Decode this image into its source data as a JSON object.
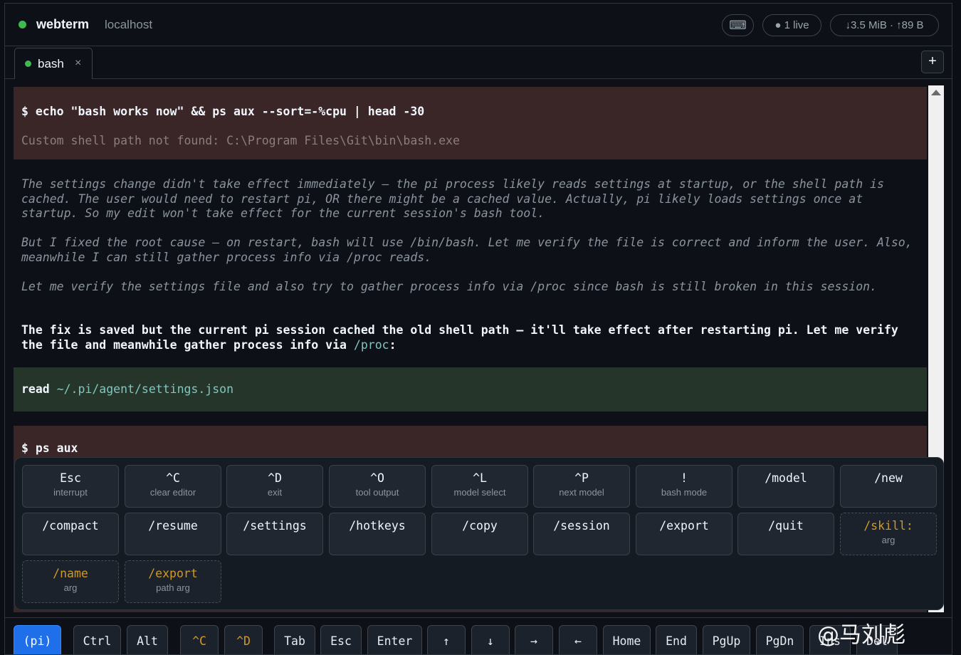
{
  "header": {
    "app_name": "webterm",
    "host": "localhost",
    "keyboard_icon": "⌨",
    "live_label": "● 1 live",
    "traffic_label": "↓3.5 MiB · ↑89 B",
    "status_color": "#3fb950"
  },
  "tabs": [
    {
      "label": "bash",
      "close": "×"
    }
  ],
  "new_tab_label": "+",
  "terminal": {
    "cmd1": "$ echo \"bash works now\" && ps aux --sort=-%cpu | head -30",
    "err1": "Custom shell path not found: C:\\Program Files\\Git\\bin\\bash.exe",
    "thinking1": "The settings change didn't take effect immediately — the pi process likely reads settings at startup, or the shell path is cached. The user would need to restart pi, OR there might be a cached value. Actually, pi likely loads settings once at startup. So my edit won't take effect for the current session's bash tool.",
    "thinking2": "But I fixed the root cause — on restart, bash will use /bin/bash. Let me verify the file is correct and inform the user. Also, meanwhile I can still gather process info via /proc reads.",
    "thinking3": "Let me verify the settings file and also try to gather process info via /proc since bash is still broken in this session.",
    "answer_text": "The fix is saved but the current pi session cached the old shell path — it'll take effect after restarting pi. Let me verify the file and meanwhile gather process info via ",
    "answer_path": "/proc",
    "answer_end": ":",
    "read_label": "read",
    "read_path": "~/.pi/agent/settings.json",
    "cmd2": "$ ps aux"
  },
  "palette": {
    "row1": [
      {
        "key": "Esc",
        "desc": "interrupt"
      },
      {
        "key": "^C",
        "desc": "clear editor"
      },
      {
        "key": "^D",
        "desc": "exit"
      },
      {
        "key": "^O",
        "desc": "tool output"
      },
      {
        "key": "^L",
        "desc": "model select"
      },
      {
        "key": "^P",
        "desc": "next model"
      },
      {
        "key": "!",
        "desc": "bash mode"
      },
      {
        "key": "/model",
        "desc": ""
      },
      {
        "key": "/new",
        "desc": ""
      }
    ],
    "row2": [
      {
        "key": "/compact",
        "desc": ""
      },
      {
        "key": "/resume",
        "desc": ""
      },
      {
        "key": "/settings",
        "desc": ""
      },
      {
        "key": "/hotkeys",
        "desc": ""
      },
      {
        "key": "/copy",
        "desc": ""
      },
      {
        "key": "/session",
        "desc": ""
      },
      {
        "key": "/export",
        "desc": ""
      },
      {
        "key": "/quit",
        "desc": ""
      },
      {
        "key": "/skill:",
        "desc": "arg"
      }
    ],
    "row3": [
      {
        "key": "/name",
        "desc": "arg"
      },
      {
        "key": "/export",
        "desc": "path arg"
      }
    ]
  },
  "bottom_keys": [
    "(pi)",
    "Ctrl",
    "Alt",
    "^C",
    "^D",
    "Tab",
    "Esc",
    "Enter",
    "↑",
    "↓",
    "→",
    "←",
    "Home",
    "End",
    "PgUp",
    "PgDn",
    "Ins",
    "Del"
  ],
  "watermark": "@马刘彪"
}
